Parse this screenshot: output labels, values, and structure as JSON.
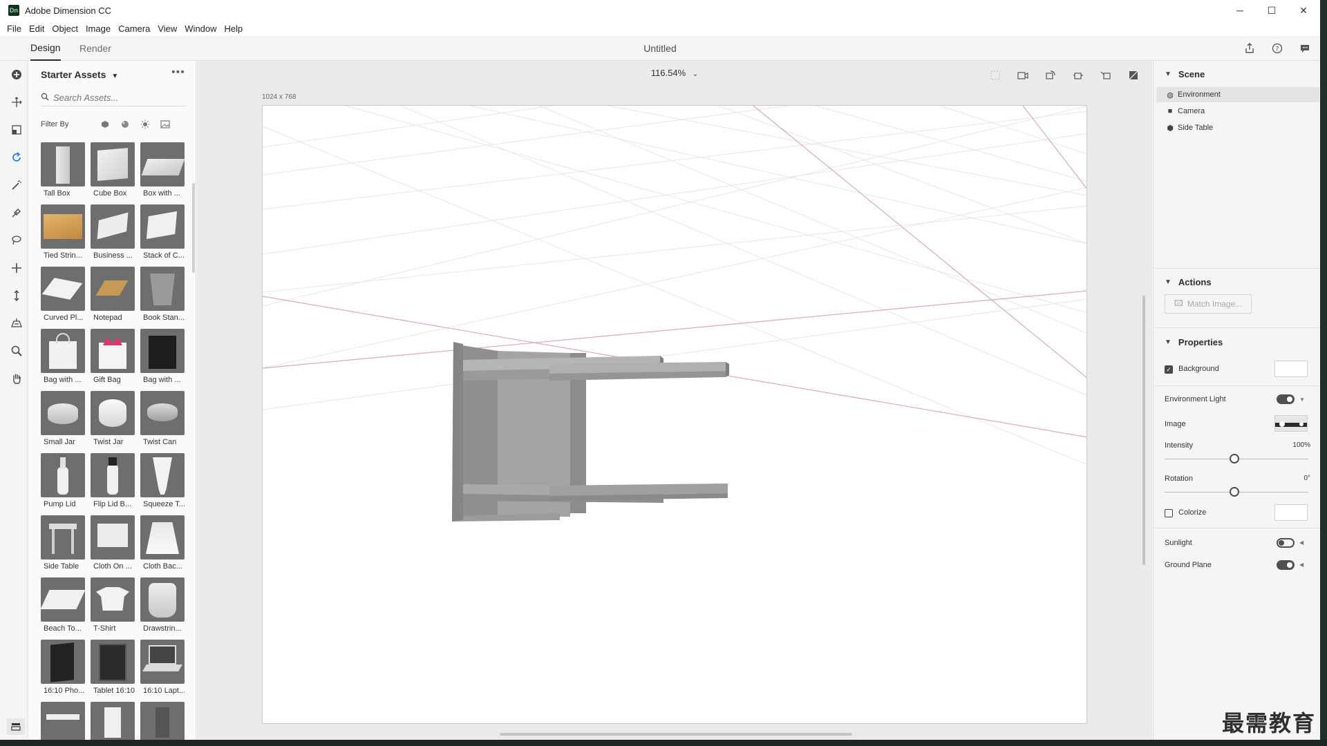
{
  "app": {
    "title": "Adobe Dimension CC",
    "logo_text": "Dn"
  },
  "menu": [
    "File",
    "Edit",
    "Object",
    "Image",
    "Camera",
    "View",
    "Window",
    "Help"
  ],
  "tabs": {
    "design": "Design",
    "render": "Render"
  },
  "document_title": "Untitled",
  "assets_panel": {
    "title": "Starter Assets",
    "search_placeholder": "Search Assets...",
    "filter_label": "Filter By",
    "items": [
      "Tall Box",
      "Cube Box",
      "Box with ...",
      "Tied Strin...",
      "Business ...",
      "Stack of C...",
      "Curved Pl...",
      "Notepad",
      "Book Stan...",
      "Bag with ...",
      "Gift Bag",
      "Bag with ...",
      "Small Jar",
      "Twist Jar",
      "Twist Can",
      "Pump Lid",
      "Flip Lid B...",
      "Squeeze T...",
      "Side Table",
      "Cloth On ...",
      "Cloth Bac...",
      "Beach To...",
      "T-Shirt",
      "Drawstrin...",
      "16:10 Pho...",
      "Tablet 16:10",
      "16:10 Lapt..."
    ]
  },
  "viewport": {
    "zoom": "116.54%",
    "canvas_size": "1024 x 768"
  },
  "scene_panel": {
    "title": "Scene",
    "items": [
      "Environment",
      "Camera",
      "Side Table"
    ]
  },
  "actions_panel": {
    "title": "Actions",
    "match_image": "Match Image..."
  },
  "properties_panel": {
    "title": "Properties",
    "background": "Background",
    "environment_light": "Environment Light",
    "image": "Image",
    "intensity": "Intensity",
    "intensity_value": "100%",
    "rotation": "Rotation",
    "rotation_value": "0°",
    "colorize": "Colorize",
    "sunlight": "Sunlight",
    "ground_plane": "Ground Plane"
  },
  "watermark": "最需教育"
}
